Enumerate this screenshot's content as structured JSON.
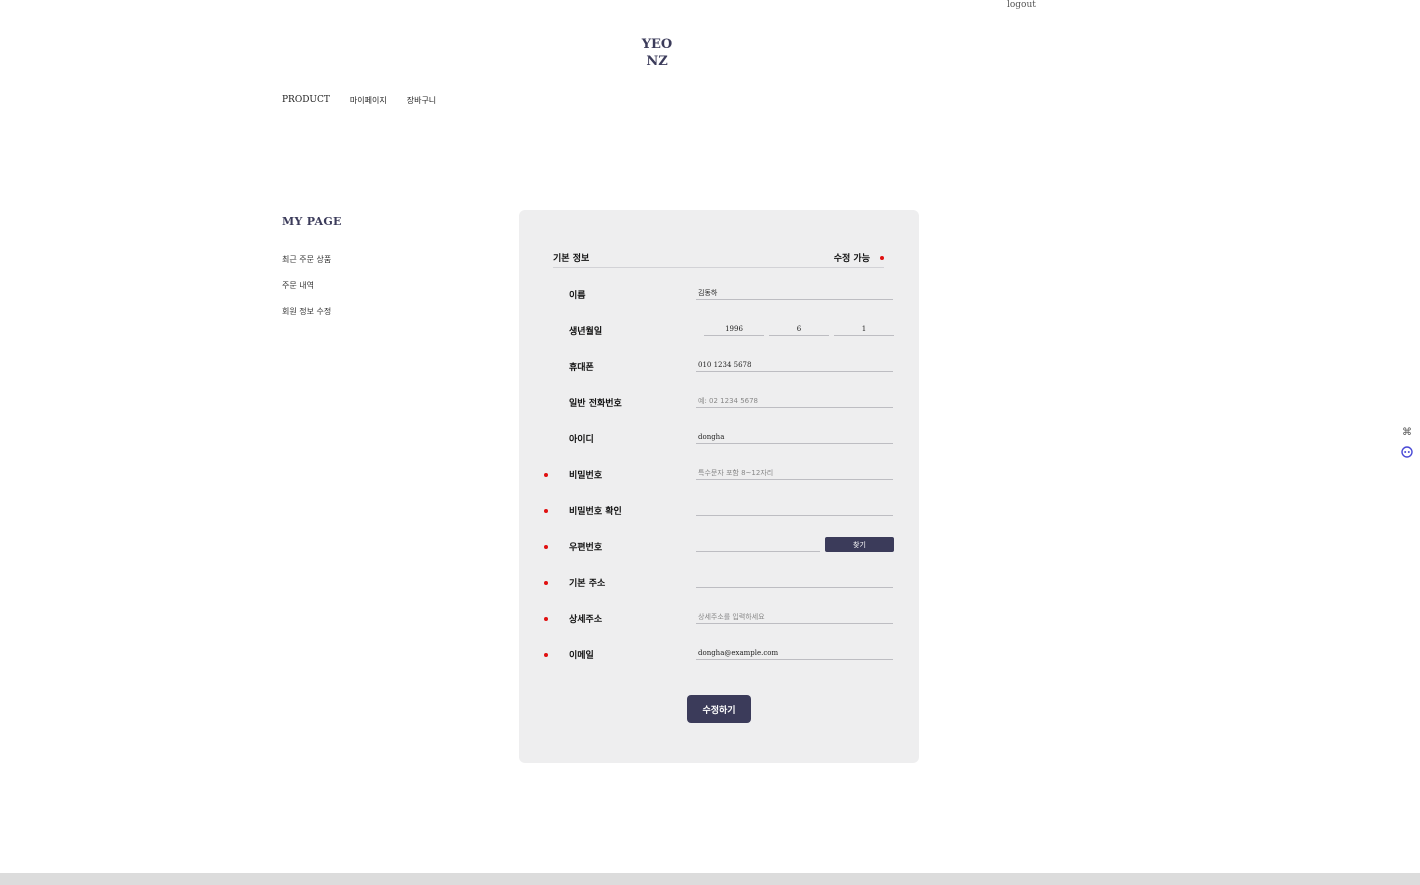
{
  "header": {
    "logout": "logout",
    "logo_line1": "YEO",
    "logo_line2": "NZ"
  },
  "nav": {
    "product": "PRODUCT",
    "mypage": "마이페이지",
    "cart": "장바구니"
  },
  "sidebar": {
    "title": "MY PAGE",
    "items": [
      {
        "label": "최근 주문 상품"
      },
      {
        "label": "주문 내역"
      },
      {
        "label": "회원 정보 수정"
      }
    ]
  },
  "form": {
    "section_title": "기본 정보",
    "editable_label": "수정 가능",
    "name": {
      "label": "이름",
      "value": "김동하"
    },
    "birth": {
      "label": "생년월일",
      "year": "1996",
      "month": "6",
      "day": "1"
    },
    "mobile": {
      "label": "휴대폰",
      "value": "010 1234 5678"
    },
    "phone": {
      "label": "일반 전화번호",
      "placeholder": "예: 02 1234 5678"
    },
    "user_id": {
      "label": "아이디",
      "value": "dongha"
    },
    "password": {
      "label": "비밀번호",
      "placeholder": "특수문자 포함 8~12자리"
    },
    "password_confirm": {
      "label": "비밀번호 확인"
    },
    "zipcode": {
      "label": "우편번호",
      "button": "찾기"
    },
    "address": {
      "label": "기본 주소"
    },
    "address_detail": {
      "label": "상세주소",
      "placeholder": "상세주소를 입력하세요"
    },
    "email": {
      "label": "이메일",
      "value": "dongha@example.com"
    },
    "submit": "수정하기"
  },
  "colors": {
    "accent": "#3b3b5a",
    "required_dot": "#e01010",
    "panel_bg": "#eeeeef"
  }
}
